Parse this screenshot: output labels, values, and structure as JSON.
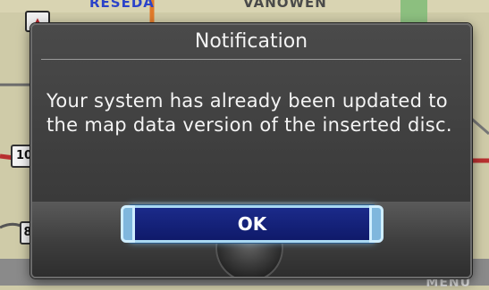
{
  "map": {
    "street_top_left": "RESEDA",
    "street_top_center": "VANOWEN",
    "route_shield_1": "10",
    "route_shield_2": "8",
    "corner_button": "MENU"
  },
  "dialog": {
    "title": "Notification",
    "message": "Your system has already been updated to the map data version of the inserted disc.",
    "ok_label": "OK"
  },
  "colors": {
    "dialog_bg": "#3f3f3f",
    "button_fill": "#14237a",
    "button_border": "#a9d8f2"
  }
}
